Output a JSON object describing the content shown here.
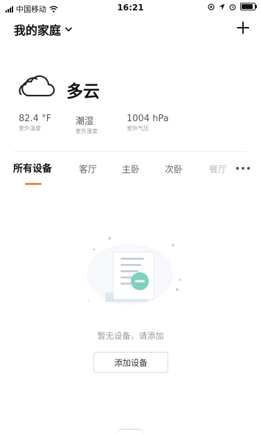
{
  "status_bar": {
    "carrier": "中国移动",
    "time": "16:21",
    "icons": [
      "signal-icon",
      "wifi-icon",
      "location-icon",
      "navigation-icon",
      "alarm-icon",
      "battery-icon"
    ]
  },
  "header": {
    "home_name": "我的家庭",
    "dropdown_icon": "chevron-down-icon",
    "add_icon": "plus-icon"
  },
  "weather": {
    "icon": "cloud-icon",
    "condition": "多云",
    "metrics": [
      {
        "value": "82.4 °F",
        "label": "室外温度"
      },
      {
        "value": "潮湿",
        "label": "室外湿度"
      },
      {
        "value": "1004 hPa",
        "label": "室外气压"
      }
    ]
  },
  "tabs": {
    "items": [
      "所有设备",
      "客厅",
      "主卧",
      "次卧",
      "餐厅"
    ],
    "active_index": 0,
    "more_icon": "more-icon",
    "accent_color": "#e8893c"
  },
  "empty_state": {
    "illustration": "document-minus-icon",
    "message": "暂无设备，请添加",
    "button_label": "添加设备"
  }
}
